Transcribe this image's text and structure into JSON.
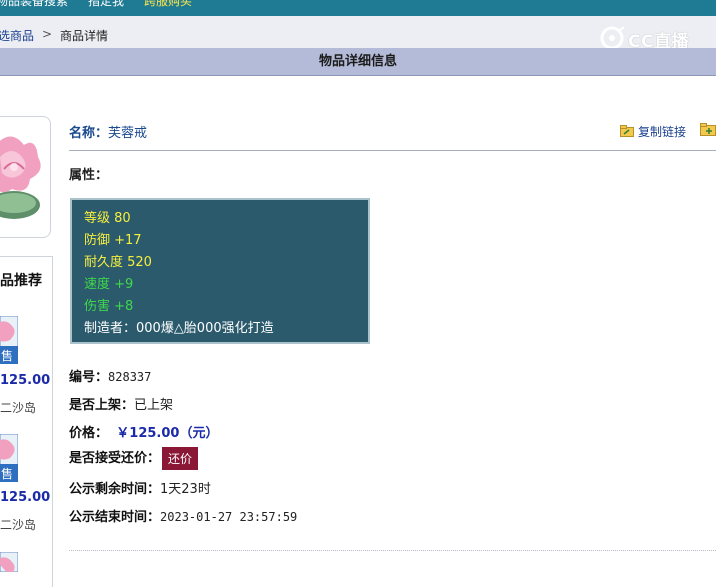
{
  "topnav": {
    "items": [
      "物品装备搜索",
      "指定我",
      "跨服购买"
    ]
  },
  "breadcrumb": {
    "link": "选商品",
    "separator": ">",
    "current": "商品详情"
  },
  "watermark": {
    "text": "CC直播"
  },
  "page_title": "物品详细信息",
  "item": {
    "name_label": "名称：",
    "name": "芙蓉戒",
    "copy_link": "复制链接",
    "attr_label": "属性：",
    "attributes": [
      {
        "text": "等级 80",
        "color": "#f6ef3e"
      },
      {
        "text": "防御 +17",
        "color": "#f6ef3e"
      },
      {
        "text": "耐久度 520",
        "color": "#f6ef3e"
      },
      {
        "text": "速度 +9",
        "color": "#3fd94a"
      },
      {
        "text": "伤害 +8",
        "color": "#3fd94a"
      },
      {
        "text": "制造者：000爆△胎000强化打造",
        "color": "#ffffff"
      }
    ]
  },
  "info": {
    "id_label": "编号：",
    "id": "828337",
    "listed_label": "是否上架：",
    "listed": "已上架",
    "price_label": "价格：",
    "price": "￥125.00（元）",
    "bargain_label": "是否接受还价：",
    "bargain_button": "还价",
    "remaining_label": "公示剩余时间：",
    "remaining": "1天23时",
    "end_label": "公示结束时间：",
    "end": "2023-01-27 23:57:59"
  },
  "recommend": {
    "title": "品推荐",
    "items": [
      {
        "price": "125.00",
        "server": "二沙岛",
        "badge": "售"
      },
      {
        "price": "125.00",
        "server": "二沙岛",
        "badge": "售"
      }
    ]
  }
}
